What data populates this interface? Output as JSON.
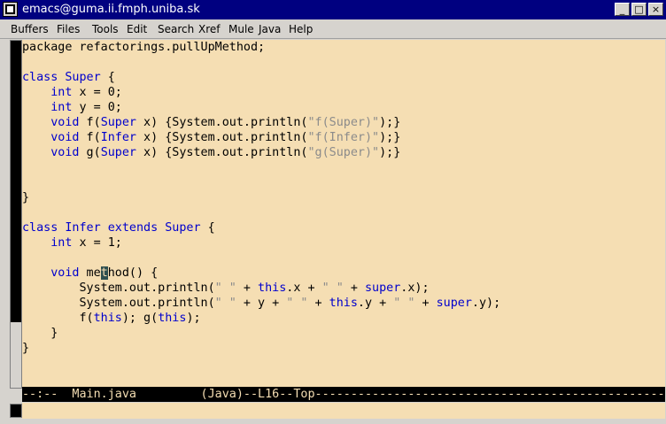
{
  "window": {
    "title": "emacs@guma.ii.fmph.uniba.sk",
    "minimize_glyph": "_",
    "maximize_glyph": "□",
    "close_glyph": "×"
  },
  "menu": [
    "Buffers",
    "Files",
    "Tools",
    "Edit",
    "Search",
    "Xref",
    "Mule",
    "Java",
    "Help"
  ],
  "code_lines": [
    [
      {
        "t": "package refactorings.pullUpMethod;",
        "c": ""
      }
    ],
    [],
    [
      {
        "t": "class Super",
        "c": "kw"
      },
      {
        "t": " {",
        "c": ""
      }
    ],
    [
      {
        "t": "    ",
        "c": ""
      },
      {
        "t": "int",
        "c": "kw"
      },
      {
        "t": " x = 0;",
        "c": ""
      }
    ],
    [
      {
        "t": "    ",
        "c": ""
      },
      {
        "t": "int",
        "c": "kw"
      },
      {
        "t": " y = 0;",
        "c": ""
      }
    ],
    [
      {
        "t": "    ",
        "c": ""
      },
      {
        "t": "void",
        "c": "kw"
      },
      {
        "t": " f(",
        "c": ""
      },
      {
        "t": "Super",
        "c": "kw"
      },
      {
        "t": " x) {System.out.println(",
        "c": ""
      },
      {
        "t": "\"f(Super)\"",
        "c": "str"
      },
      {
        "t": ");}",
        "c": ""
      }
    ],
    [
      {
        "t": "    ",
        "c": ""
      },
      {
        "t": "void",
        "c": "kw"
      },
      {
        "t": " f(",
        "c": ""
      },
      {
        "t": "Infer",
        "c": "kw"
      },
      {
        "t": " x) {System.out.println(",
        "c": ""
      },
      {
        "t": "\"f(Infer)\"",
        "c": "str"
      },
      {
        "t": ");}",
        "c": ""
      }
    ],
    [
      {
        "t": "    ",
        "c": ""
      },
      {
        "t": "void",
        "c": "kw"
      },
      {
        "t": " g(",
        "c": ""
      },
      {
        "t": "Super",
        "c": "kw"
      },
      {
        "t": " x) {System.out.println(",
        "c": ""
      },
      {
        "t": "\"g(Super)\"",
        "c": "str"
      },
      {
        "t": ");}",
        "c": ""
      }
    ],
    [],
    [],
    [
      {
        "t": "}",
        "c": ""
      }
    ],
    [],
    [
      {
        "t": "class Infer extends Super",
        "c": "kw"
      },
      {
        "t": " {",
        "c": ""
      }
    ],
    [
      {
        "t": "    ",
        "c": ""
      },
      {
        "t": "int",
        "c": "kw"
      },
      {
        "t": " x = 1;",
        "c": ""
      }
    ],
    [],
    [
      {
        "t": "    ",
        "c": ""
      },
      {
        "t": "void",
        "c": "kw"
      },
      {
        "t": " me",
        "c": ""
      },
      {
        "t": "t",
        "c": "cursor"
      },
      {
        "t": "hod() {",
        "c": ""
      }
    ],
    [
      {
        "t": "        System.out.println(",
        "c": ""
      },
      {
        "t": "\" \"",
        "c": "str"
      },
      {
        "t": " + ",
        "c": ""
      },
      {
        "t": "this",
        "c": "kw"
      },
      {
        "t": ".x + ",
        "c": ""
      },
      {
        "t": "\" \"",
        "c": "str"
      },
      {
        "t": " + ",
        "c": ""
      },
      {
        "t": "super",
        "c": "kw"
      },
      {
        "t": ".x);",
        "c": ""
      }
    ],
    [
      {
        "t": "        System.out.println(",
        "c": ""
      },
      {
        "t": "\" \"",
        "c": "str"
      },
      {
        "t": " + y + ",
        "c": ""
      },
      {
        "t": "\" \"",
        "c": "str"
      },
      {
        "t": " + ",
        "c": ""
      },
      {
        "t": "this",
        "c": "kw"
      },
      {
        "t": ".y + ",
        "c": ""
      },
      {
        "t": "\" \"",
        "c": "str"
      },
      {
        "t": " + ",
        "c": ""
      },
      {
        "t": "super",
        "c": "kw"
      },
      {
        "t": ".y);",
        "c": ""
      }
    ],
    [
      {
        "t": "        f(",
        "c": ""
      },
      {
        "t": "this",
        "c": "kw"
      },
      {
        "t": "); g(",
        "c": ""
      },
      {
        "t": "this",
        "c": "kw"
      },
      {
        "t": ");",
        "c": ""
      }
    ],
    [
      {
        "t": "    }",
        "c": ""
      }
    ],
    [
      {
        "t": "}",
        "c": ""
      }
    ]
  ],
  "modeline": "--:--  Main.java         (Java)--L16--Top--------------------------------------------------------",
  "minibuffer": "",
  "colors": {
    "titlebar": "#000080",
    "text_bg": "#f5deb3",
    "keyword": "#0000cd",
    "string": "#8b8b8b",
    "modeline_bg": "#000000"
  }
}
